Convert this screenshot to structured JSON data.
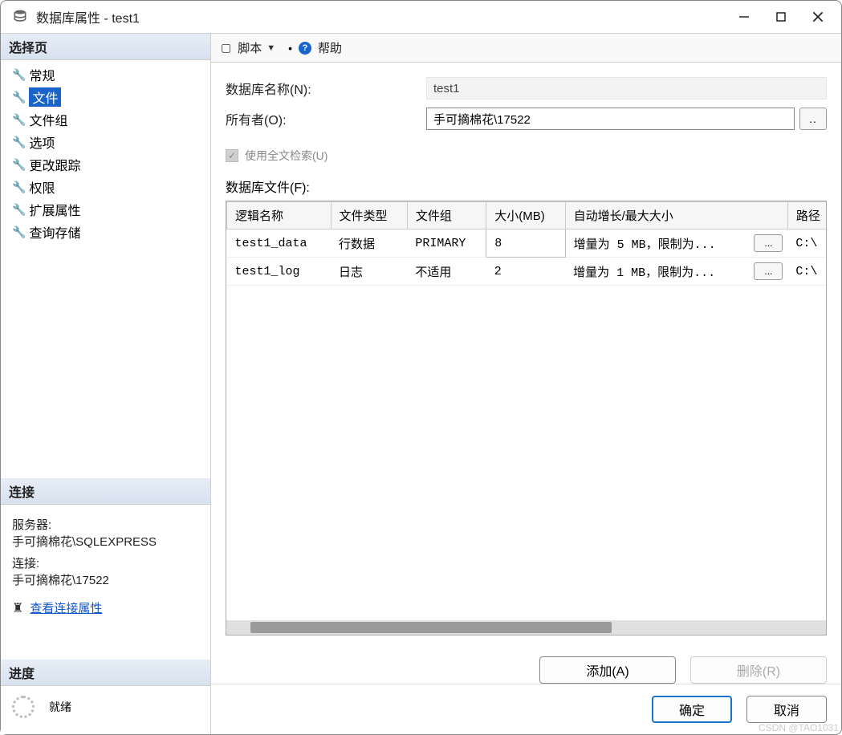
{
  "window": {
    "title": "数据库属性 - test1"
  },
  "sidebar": {
    "select_page_header": "选择页",
    "items": [
      {
        "label": "常规"
      },
      {
        "label": "文件"
      },
      {
        "label": "文件组"
      },
      {
        "label": "选项"
      },
      {
        "label": "更改跟踪"
      },
      {
        "label": "权限"
      },
      {
        "label": "扩展属性"
      },
      {
        "label": "查询存储"
      }
    ],
    "selected_index": 1,
    "connection_header": "连接",
    "server_label": "服务器:",
    "server_value": "手可摘棉花\\SQLEXPRESS",
    "conn_label": "连接:",
    "conn_value": "手可摘棉花\\17522",
    "view_conn_props": "查看连接属性",
    "progress_header": "进度",
    "progress_status": "就绪"
  },
  "toolbar": {
    "script": "脚本",
    "help": "帮助"
  },
  "form": {
    "db_name_label": "数据库名称(N):",
    "db_name_value": "test1",
    "owner_label": "所有者(O):",
    "owner_value": "手可摘棉花\\17522",
    "fulltext_label": "使用全文检索(U)",
    "files_label": "数据库文件(F):"
  },
  "table": {
    "headers": [
      "逻辑名称",
      "文件类型",
      "文件组",
      "大小(MB)",
      "自动增长/最大大小",
      "路径"
    ],
    "rows": [
      {
        "logical": "test1_data",
        "type": "行数据",
        "group": "PRIMARY",
        "size": "8",
        "growth": "增量为 5 MB，限制为...",
        "path": "C:\\"
      },
      {
        "logical": "test1_log",
        "type": "日志",
        "group": "不适用",
        "size": "2",
        "growth": "增量为 1 MB，限制为...",
        "path": "C:\\"
      }
    ]
  },
  "buttons": {
    "add": "添加(A)",
    "remove": "删除(R)",
    "ok": "确定",
    "cancel": "取消"
  },
  "watermark": "CSDN @TAO1031"
}
